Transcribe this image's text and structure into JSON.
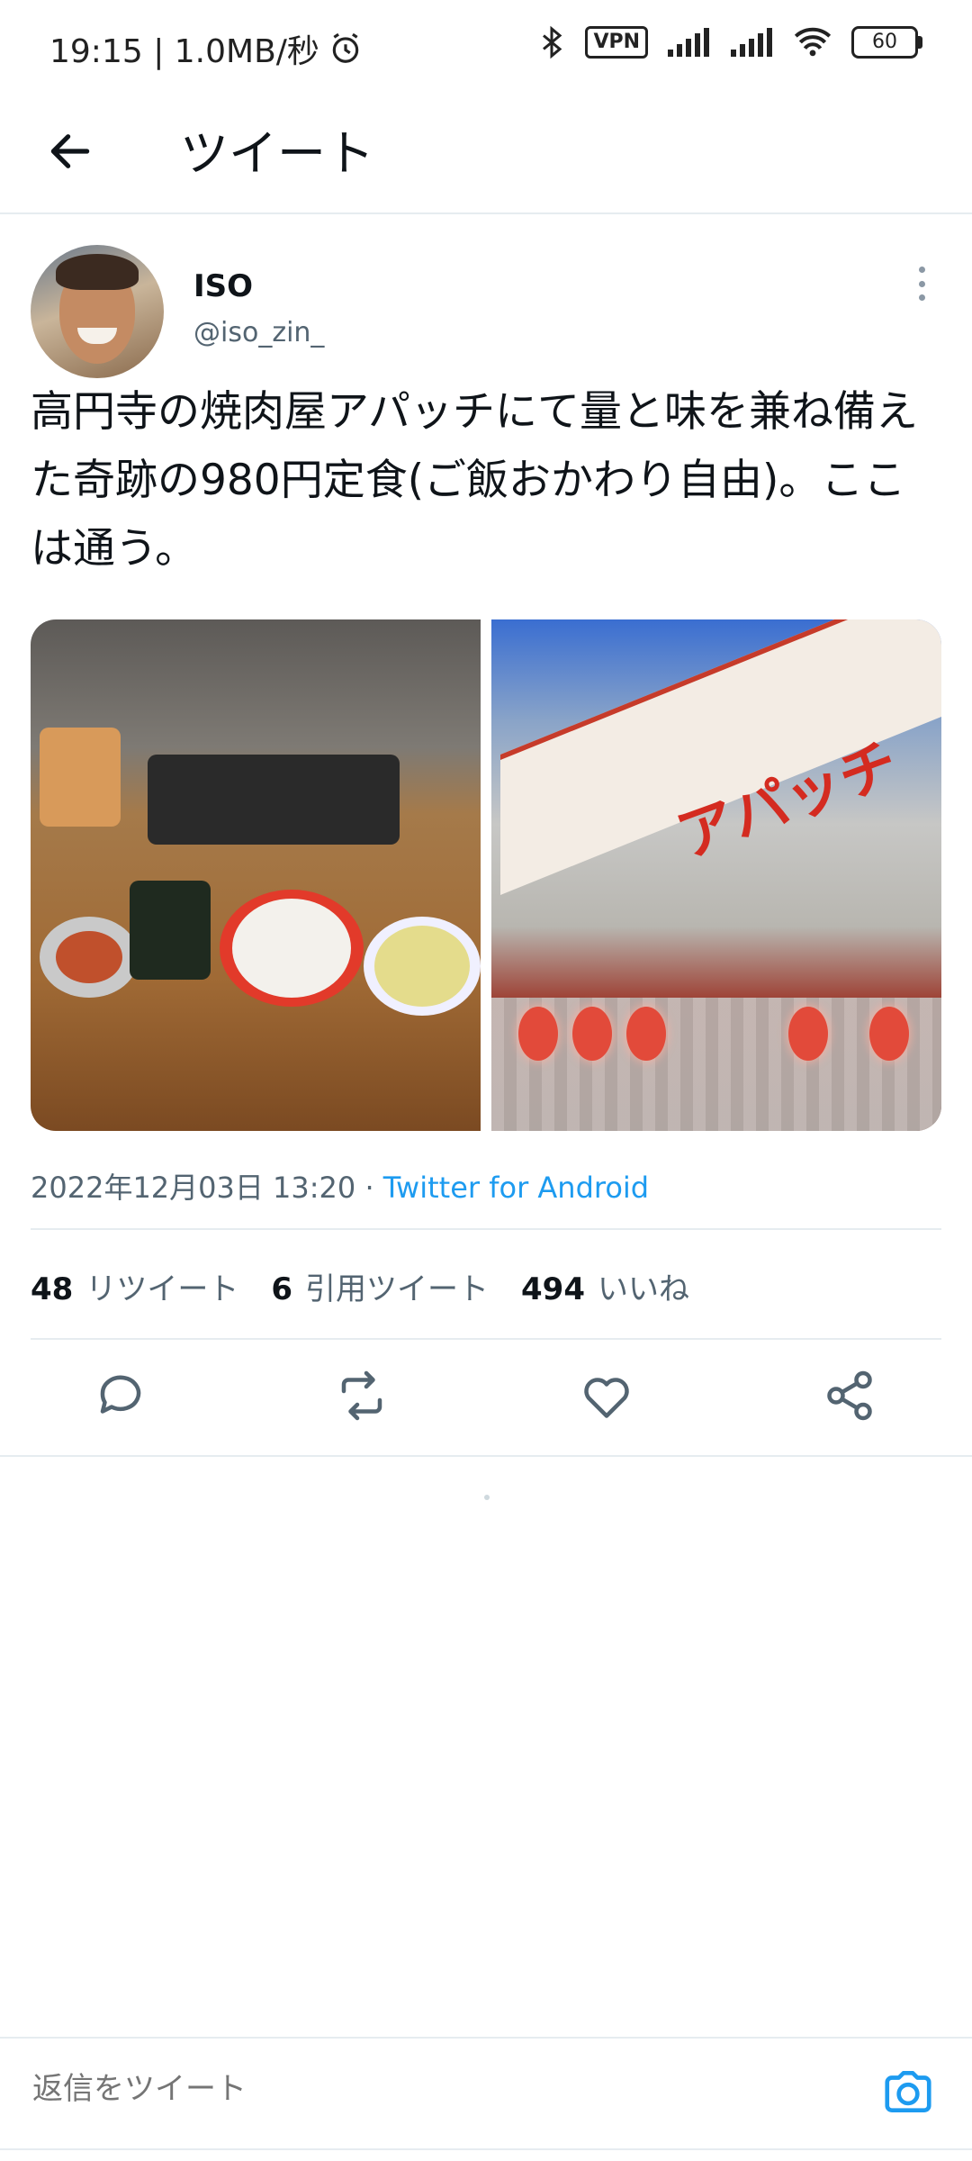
{
  "status_bar": {
    "time_speed": "19:15 | 1.0MB/秒",
    "vpn": "VPN",
    "battery": "60"
  },
  "appbar": {
    "title": "ツイート"
  },
  "tweet": {
    "author_name": "ISO",
    "author_handle": "@iso_zin_",
    "text": "高円寺の焼肉屋アパッチにて量と味を兼ね備えた奇跡の980円定食(ご飯おかわり自由)。ここは通う。",
    "timestamp": "2022年12月03日 13:20 · ",
    "source": "Twitter for Android",
    "images": [
      {
        "icon": "food-photo"
      },
      {
        "icon": "storefront-photo",
        "sign_text": "アパッチ"
      }
    ],
    "stats": {
      "retweets_count": "48",
      "retweets_label": "リツイート",
      "quotes_count": "6",
      "quotes_label": "引用ツイート",
      "likes_count": "494",
      "likes_label": "いいね"
    }
  },
  "reply": {
    "placeholder": "返信をツイート"
  },
  "colors": {
    "accent": "#1d9bf0",
    "secondary_text": "#536471",
    "divider": "#e6ecf0"
  }
}
